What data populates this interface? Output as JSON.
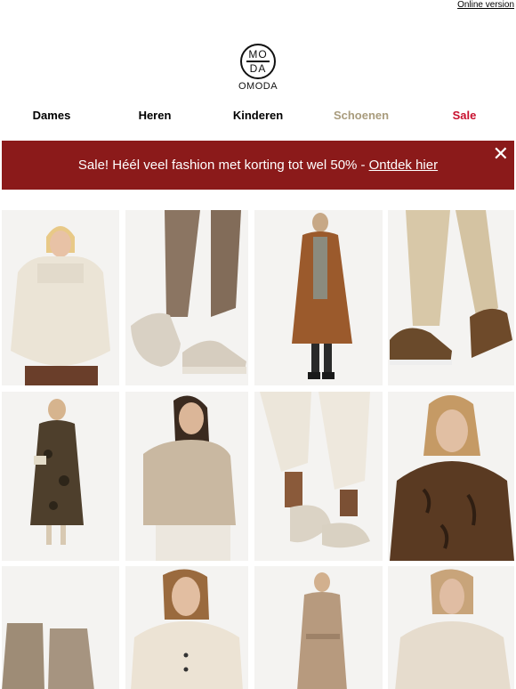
{
  "header": {
    "online_version": "Online version"
  },
  "logo": {
    "mark_top": "MO",
    "mark_bottom": "DA",
    "name": "OMODA"
  },
  "nav": {
    "dames": "Dames",
    "heren": "Heren",
    "kinderen": "Kinderen",
    "schoenen": "Schoenen",
    "sale": "Sale"
  },
  "banner": {
    "text": "Sale! Héél veel fashion met korting tot wel 50% -",
    "link": "Ontdek hier",
    "close_icon": "close-icon",
    "color": "#8b1a1a"
  },
  "colors": {
    "shoes_nav": "#a99c7d",
    "sale_nav": "#c8102e"
  }
}
